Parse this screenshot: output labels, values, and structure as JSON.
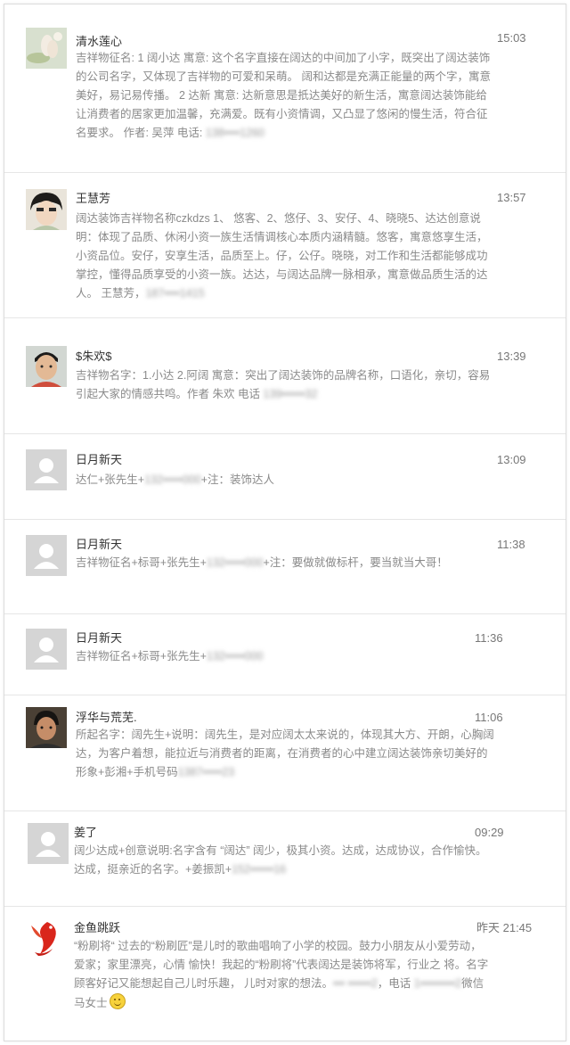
{
  "comments": [
    {
      "name": "清水莲心",
      "time": "15:03",
      "text": "吉祥物征名: 1 阔小达 寓意: 这个名字直接在阔达的中间加了小字，既突出了阔达装饰的公司名字，又体现了吉祥物的可爱和呆萌。 阔和达都是充满正能量的两个字，寓意美好，易记易传播。 2 达新 寓意: 达新意思是扺达美好的新生活，寓意阔达装饰能给让消费者的居家更加温馨，充满爱。既有小资情调，又凸显了悠闲的慢生活，符合征名要求。 作者: 吴萍 电话: ",
      "hidden": "138••••1260",
      "avatar": "lotus-photo"
    },
    {
      "name": "王慧芳",
      "time": "13:57",
      "text": "阔达装饰吉祥物名称czkdzs 1、 悠客、2、悠仔、3、安仔、4、晓晓5、达达创意说明：体现了品质、休闲小资一族生活情调核心本质内涵精髓。悠客，寓意悠享生活，小资品位。安仔，安享生活，品质至上。仔，公仔。晓晓，对工作和生活都能够成功掌控，懂得品质享受的小资一族。达达，与阔达品牌一脉相承，寓意做品质生活的达人。 王慧芳，",
      "hidden": "187••••1415",
      "avatar": "girl-photo"
    },
    {
      "name": "$朱欢$",
      "time": "13:39",
      "text": "吉祥物名字：1.小达 2.阿阔 寓意：突出了阔达装饰的品牌名称，口语化，亲切，容易引起大家的情感共鸣。作者 朱欢 电话 ",
      "hidden": "139••••••32",
      "avatar": "boy-photo"
    },
    {
      "name": "日月新天",
      "time": "13:09",
      "text": "达仁+张先生+",
      "hidden": "132•••••000",
      "text_after": "+注：装饰达人",
      "avatar": "default"
    },
    {
      "name": "日月新天",
      "time": "11:38",
      "text": "吉祥物征名+标哥+张先生+",
      "hidden": "132•••••000",
      "text_after": "+注：要做就做标杆，要当就当大哥！",
      "avatar": "default"
    },
    {
      "name": "日月新天",
      "time": "11:36",
      "text": "吉祥物征名+标哥+张先生+",
      "hidden": "132•••••000",
      "avatar": "default"
    },
    {
      "name": "浮华与荒芜.",
      "time": "11:06",
      "text": "所起名字：阔先生+说明：阔先生，是对应阔太太来说的，体现其大方、开朗，心胸阔达，为客户着想，能拉近与消费者的距离，在消费者的心中建立阔达装饰亲切美好的形象+彭湘+手机号码",
      "hidden": "1387•••••23",
      "avatar": "man-photo"
    },
    {
      "name": "姜了",
      "time": "09:29",
      "text": "阔少达成+创意说明:名字含有 “阔达” 阔少，极其小资。达成，达成协议，合作愉快。达成，挺亲近的名字。+姜振凯+",
      "hidden": "152••••••16",
      "avatar": "default"
    },
    {
      "name": "金鱼跳跃",
      "time": "昨天 21:45",
      "text": "“粉刷将“ 过去的“粉刷匠”是儿时的歌曲唱响了小学的校园。鼓力小朋友从小爱劳动，爱家；家里漂亮，心情 愉快！我起的“粉刷将”代表阔达是装饰将军，行业之 将。名字顾客好记又能想起自己儿时乐趣， 儿时对家的想法。",
      "hidden": "••• ••••••2",
      "text_after": "，电话 ",
      "hidden2": "1•••••••••2",
      "text_end": "微信 马女士",
      "avatar": "goldfish-logo"
    }
  ]
}
